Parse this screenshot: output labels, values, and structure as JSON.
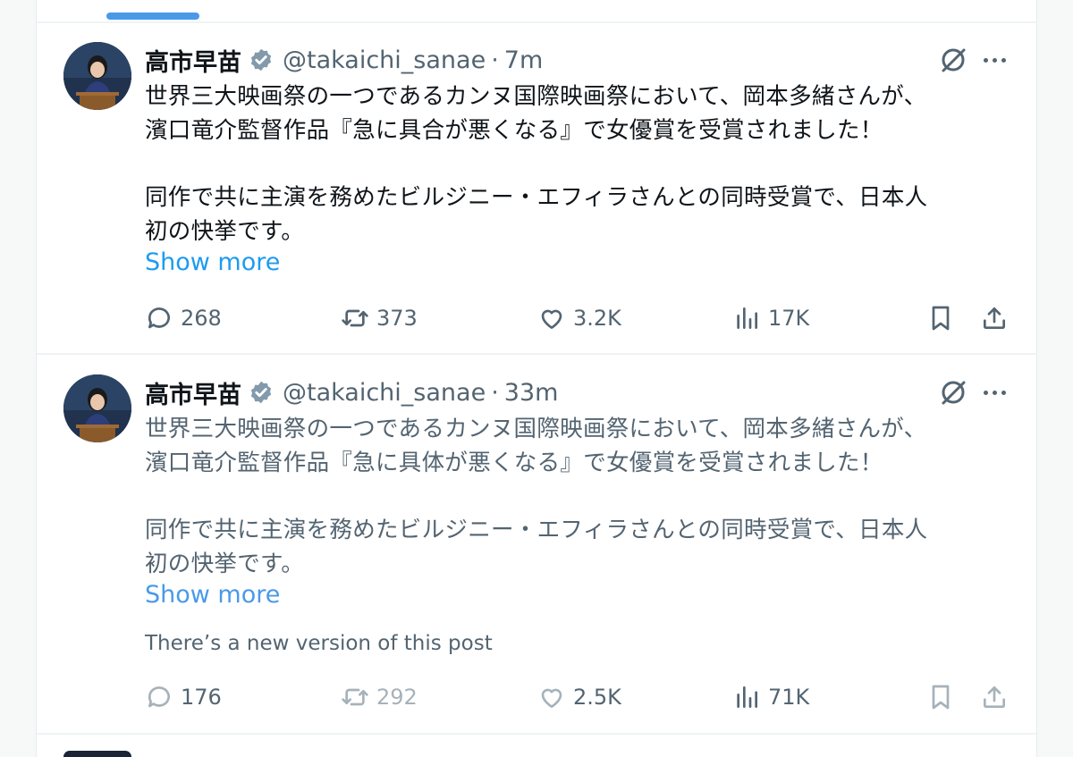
{
  "tweets": [
    {
      "name": "高市早苗",
      "handle": "@takaichi_sanae",
      "separator": "·",
      "time": "7m",
      "lines": [
        "世界三大映画祭の一つであるカンヌ国際映画祭において、岡本多緒さんが、",
        "濱口竜介監督作品『急に具合が悪くなる』で女優賞を受賞されました！",
        "同作で共に主演を務めたビルジニー・エフィラさんとの同時受賞で、日本人",
        "初の快挙です。"
      ],
      "show_more": "Show more",
      "replies": "268",
      "reposts": "373",
      "likes": "3.2K",
      "views": "17K"
    },
    {
      "name": "高市早苗",
      "handle": "@takaichi_sanae",
      "separator": "·",
      "time": "33m",
      "lines": [
        "世界三大映画祭の一つであるカンヌ国際映画祭において、岡本多緒さんが、",
        "濱口竜介監督作品『急に具体が悪くなる』で女優賞を受賞されました！",
        "同作で共に主演を務めたビルジニー・エフィラさんとの同時受賞で、日本人",
        "初の快挙です。"
      ],
      "show_more": "Show more",
      "notice": "There’s a new version of this post",
      "replies": "176",
      "reposts": "292",
      "likes": "2.5K",
      "views": "71K"
    }
  ],
  "colors": {
    "accent": "#1d9bf0",
    "text": "#0f1419",
    "secondary": "#536471",
    "verified": "#829aab"
  },
  "icons": [
    "verified-badge-icon",
    "grok-icon",
    "more-icon",
    "reply-icon",
    "repost-icon",
    "like-icon",
    "views-icon",
    "bookmark-icon",
    "share-icon"
  ]
}
